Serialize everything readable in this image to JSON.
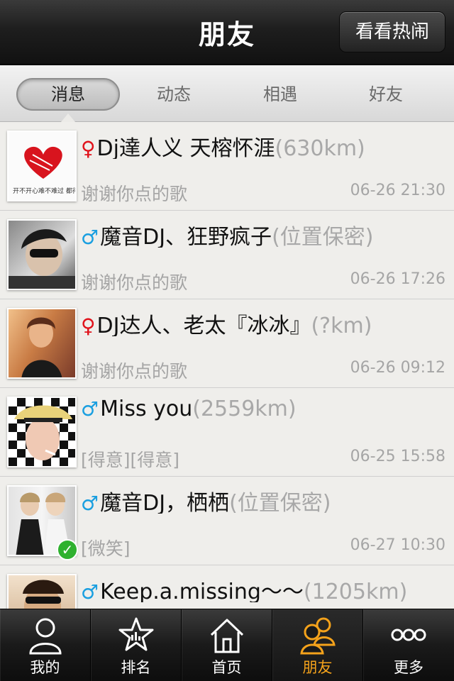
{
  "header": {
    "title": "朋友",
    "right_button": "看看热闹"
  },
  "segments": [
    {
      "label": "消息",
      "active": true
    },
    {
      "label": "动态",
      "active": false
    },
    {
      "label": "相遇",
      "active": false
    },
    {
      "label": "好友",
      "active": false
    }
  ],
  "messages": [
    {
      "gender": "female",
      "gender_symbol": "♀",
      "name": "Dj達人义  天榕怀涯",
      "distance": "(630km)",
      "text": "谢谢你点的歌",
      "time": "06-26 21:30"
    },
    {
      "gender": "male",
      "gender_symbol": "♂",
      "name": "魔音DJ、狂野疯子",
      "distance": "(位置保密)",
      "text": "谢谢你点的歌",
      "time": "06-26 17:26"
    },
    {
      "gender": "female",
      "gender_symbol": "♀",
      "name": "DJ达人、老太『冰冰』",
      "distance": "(?km)",
      "text": "谢谢你点的歌",
      "time": "06-26 09:12"
    },
    {
      "gender": "male",
      "gender_symbol": "♂",
      "name": "Miss  you",
      "distance": "(2559km)",
      "text": "[得意][得意]",
      "time": "06-25 15:58"
    },
    {
      "gender": "male",
      "gender_symbol": "♂",
      "name": "魔音DJ，栖栖",
      "distance": "(位置保密)",
      "text": "[微笑]",
      "time": "06-27 10:30"
    },
    {
      "gender": "male",
      "gender_symbol": "♂",
      "name": "Keep.a.missing～～",
      "distance": "(1205km)",
      "text": "",
      "time": ""
    }
  ],
  "avatar1_caption": "开不开心难不难过 都得过",
  "tabbar": [
    {
      "label": "我的",
      "icon": "person-icon",
      "active": false
    },
    {
      "label": "排名",
      "icon": "star-icon",
      "active": false
    },
    {
      "label": "首页",
      "icon": "home-icon",
      "active": false
    },
    {
      "label": "朋友",
      "icon": "friends-icon",
      "active": true
    },
    {
      "label": "更多",
      "icon": "more-icon",
      "active": false
    }
  ],
  "colors": {
    "female": "#e0121b",
    "male": "#1a9fe0",
    "active_tab": "#f4a21b",
    "verified": "#2fb12f"
  }
}
